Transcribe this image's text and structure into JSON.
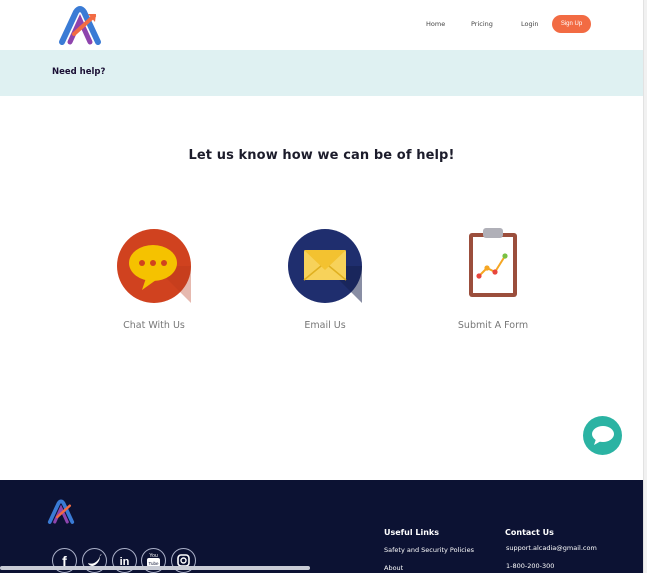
{
  "header": {
    "nav": {
      "home": "Home",
      "pricing": "Pricing",
      "login": "Login",
      "signup": "Sign Up"
    }
  },
  "band": {
    "title": "Need help?"
  },
  "main": {
    "headline": "Let us know how we can be of help!",
    "options": [
      {
        "label": "Chat With Us"
      },
      {
        "label": "Email Us"
      },
      {
        "label": "Submit A Form"
      }
    ]
  },
  "footer": {
    "social": [
      "f",
      "twitter",
      "in",
      "You Tube",
      "instagram"
    ],
    "useful_links": {
      "title": "Useful Links",
      "items": [
        "Safety and Security Policies",
        "About"
      ]
    },
    "contact": {
      "title": "Contact Us",
      "email": "support.alcadia@gmail.com",
      "phone": "1-800-200-300"
    }
  },
  "colors": {
    "accent": "#f26b43",
    "teal": "#2bb3a3",
    "footer": "#0c1233",
    "band": "#dff1f2"
  }
}
